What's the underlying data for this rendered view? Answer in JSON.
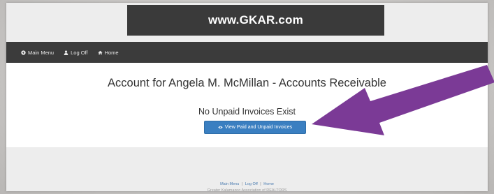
{
  "banner": {
    "text": "www.GKAR.com"
  },
  "nav": {
    "items": [
      {
        "label": "Main Menu",
        "icon": "circle-arrow-icon"
      },
      {
        "label": "Log Off",
        "icon": "user-icon"
      },
      {
        "label": "Home",
        "icon": "home-icon"
      }
    ]
  },
  "main": {
    "title": "Account for Angela M. McMillan - Accounts Receivable",
    "status": "No Unpaid Invoices Exist",
    "view_button_label": "View Paid and Unpaid Invoices",
    "view_button_icon": "eye-icon",
    "button_color": "#3a7fc1"
  },
  "footer": {
    "links": [
      "Main Menu",
      "Log Off",
      "Home"
    ],
    "separator": "|",
    "org": "Greater Kalamazoo Association of REALTORS"
  },
  "annotation": {
    "arrow_color": "#7b3a96"
  }
}
